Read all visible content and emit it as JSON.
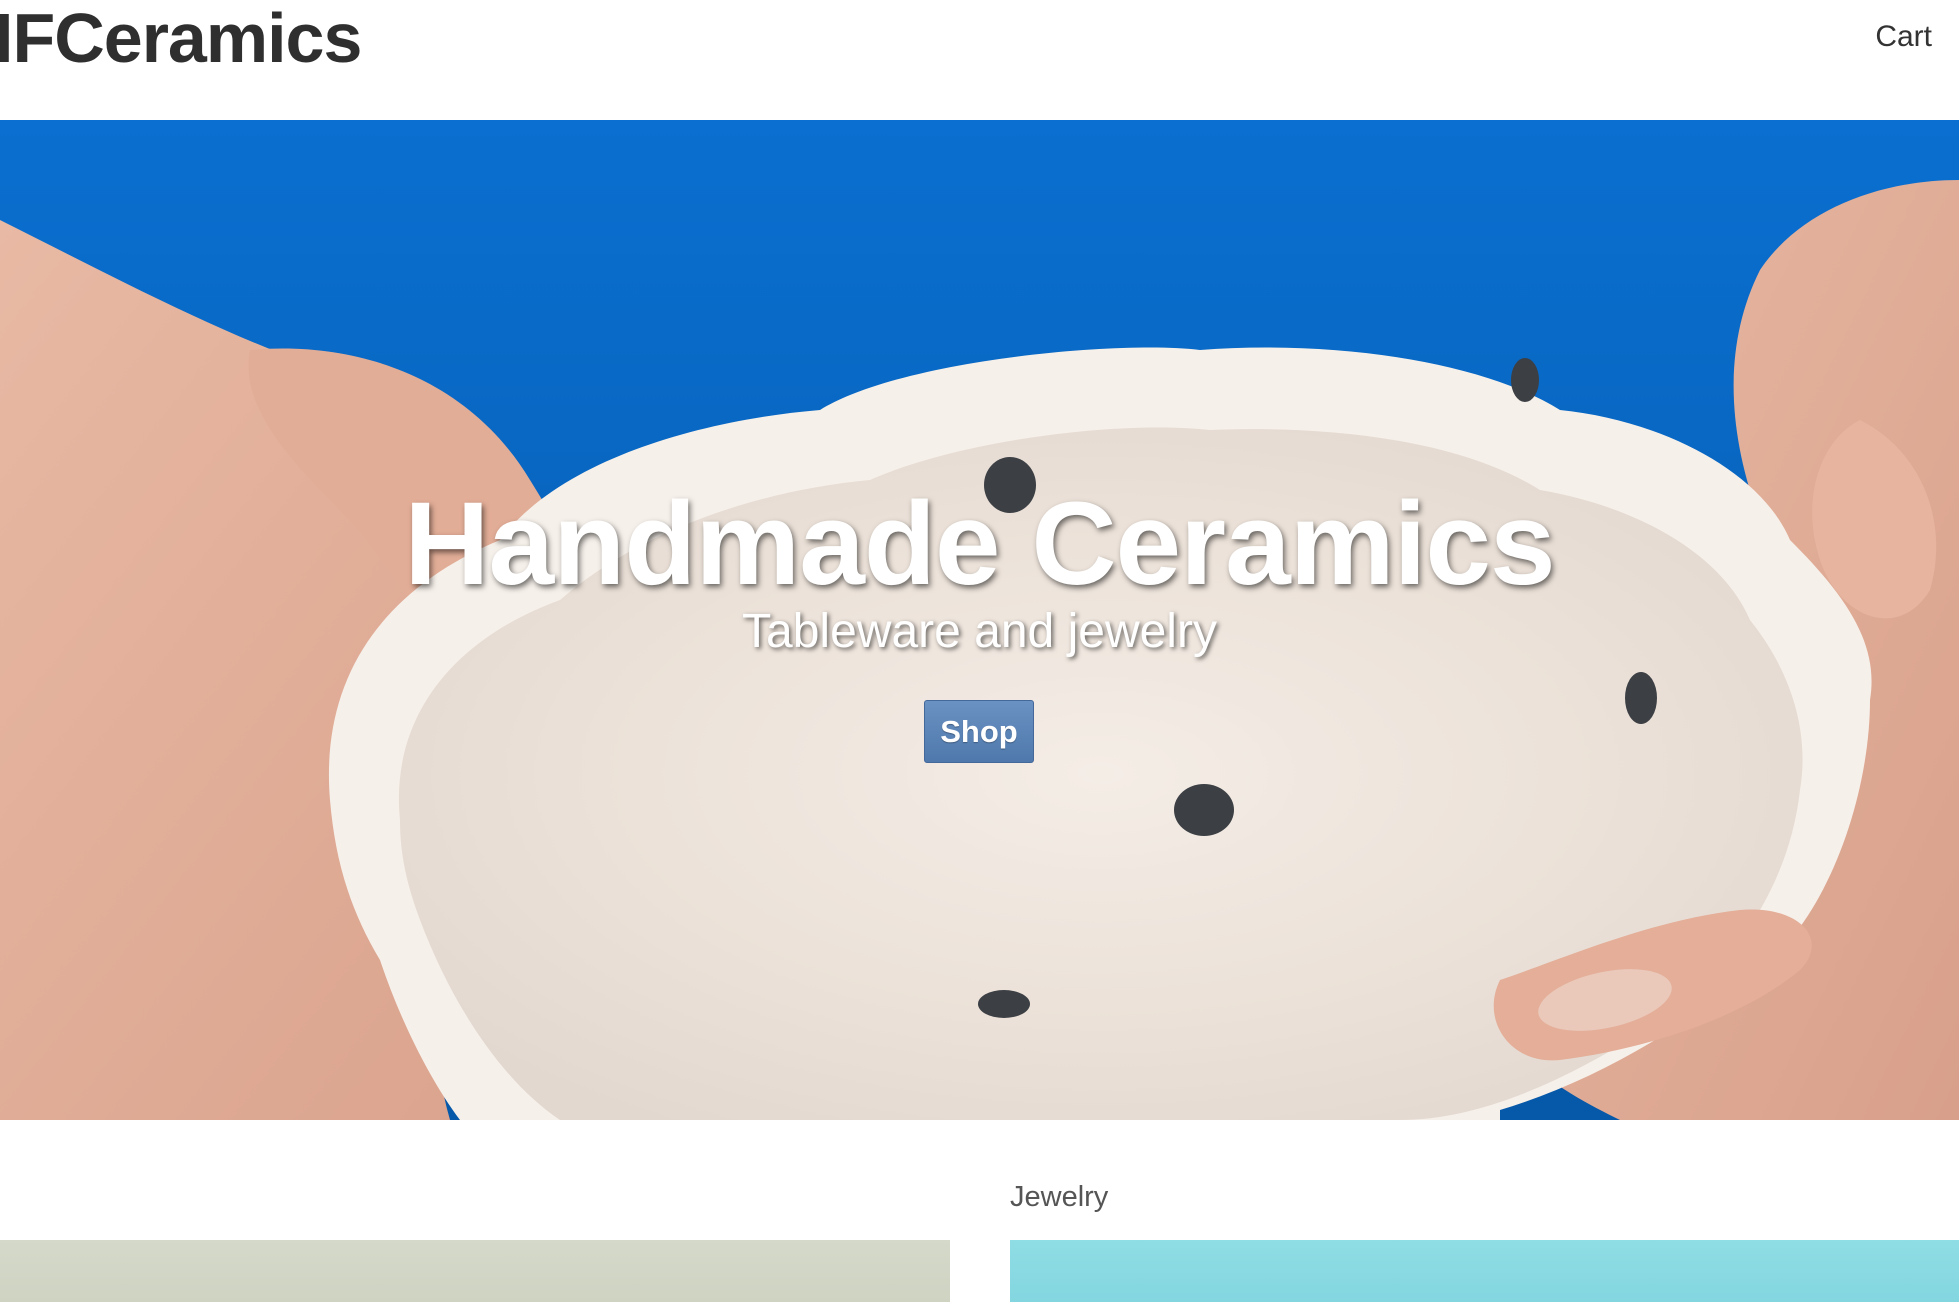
{
  "header": {
    "brand": "IFCeramics",
    "cart_label": "Cart"
  },
  "hero": {
    "title": "Handmade Ceramics",
    "subtitle": "Tableware and jewelry",
    "shop_label": "Shop"
  },
  "categories": {
    "right_label": "Jewelry"
  },
  "colors": {
    "shop_button": "#5b82b4",
    "hero_backdrop": "#0b67c4"
  },
  "icons": [
    "cart-link"
  ]
}
